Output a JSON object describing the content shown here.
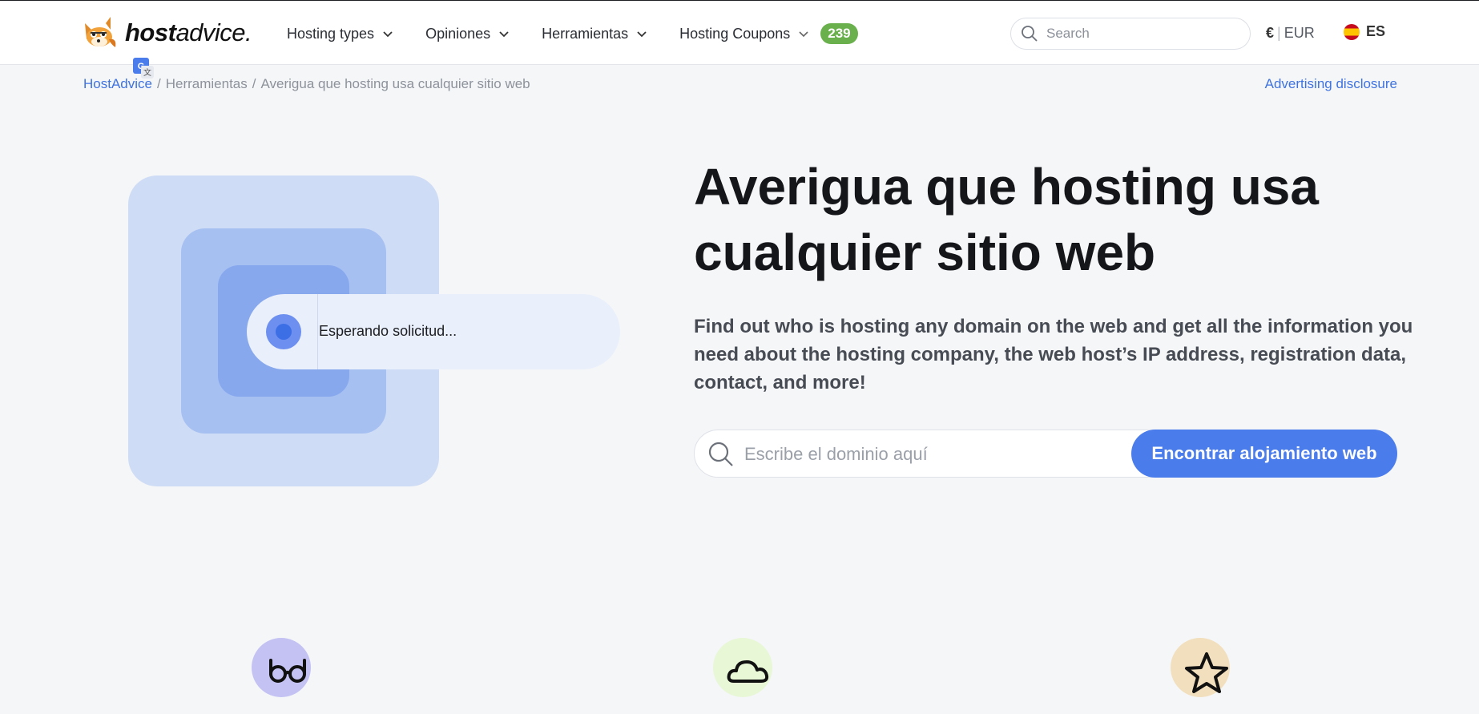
{
  "header": {
    "logo_bold": "host",
    "logo_light": "advice.",
    "nav": [
      {
        "label": "Hosting types"
      },
      {
        "label": "Opiniones"
      },
      {
        "label": "Herramientas"
      },
      {
        "label": "Hosting Coupons",
        "badge": "239"
      }
    ],
    "search_placeholder": "Search",
    "currency_symbol": "€",
    "currency_code": "EUR",
    "language": "ES"
  },
  "breadcrumb": {
    "items": [
      "HostAdvice",
      "Herramientas",
      "Averigua que hosting usa cualquier sitio web"
    ],
    "separator": "/"
  },
  "advertising_disclosure": "Advertising disclosure",
  "illustration": {
    "status_text": "Esperando solicitud..."
  },
  "hero": {
    "title": "Averigua que hosting usa cualquier sitio web",
    "description": "Find out who is hosting any domain on the web and get all the information you need about the hosting company, the web host’s IP address, registration data, contact, and more!",
    "input_placeholder": "Escribe el dominio aquí",
    "button_label": "Encontrar alojamiento web"
  },
  "features": [
    {
      "icon": "glasses-icon",
      "color": "#c4c2f3"
    },
    {
      "icon": "cloud-icon",
      "color": "#e8f7d6"
    },
    {
      "icon": "star-icon",
      "color": "#f2dfbd"
    }
  ],
  "colors": {
    "accent": "#4a7cec",
    "link": "#3f73e0",
    "badge": "#6ab04c",
    "background": "#f5f6f8"
  }
}
